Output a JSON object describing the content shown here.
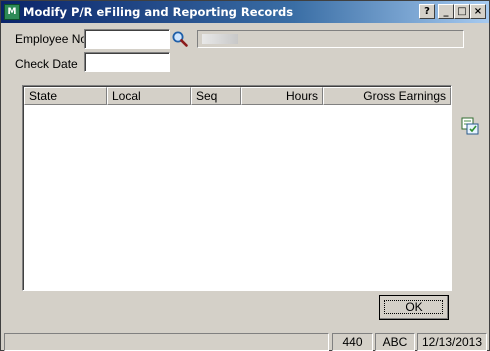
{
  "window": {
    "title": "Modify P/R eFiling and Reporting Records",
    "app_icon_text": "M",
    "help_label": "?",
    "min_label": "_",
    "max_label": "□",
    "close_label": "×"
  },
  "form": {
    "employee_no_label": "Employee No",
    "employee_no_value": "",
    "check_date_label": "Check Date",
    "check_date_value": "",
    "employee_name_value": ""
  },
  "grid": {
    "columns": [
      "State",
      "Local",
      "Seq",
      "Hours",
      "Gross Earnings"
    ],
    "rows": []
  },
  "buttons": {
    "ok_label": "OK"
  },
  "status_bar": {
    "message": "",
    "number": "440",
    "company": "ABC",
    "date": "12/13/2013"
  },
  "icons": {
    "lookup": "magnifier-icon",
    "grid_action": "multi-record-icon"
  },
  "colors": {
    "title_bar_start": "#0a246a",
    "title_bar_end": "#a6caf0",
    "face": "#d4d0c8"
  }
}
